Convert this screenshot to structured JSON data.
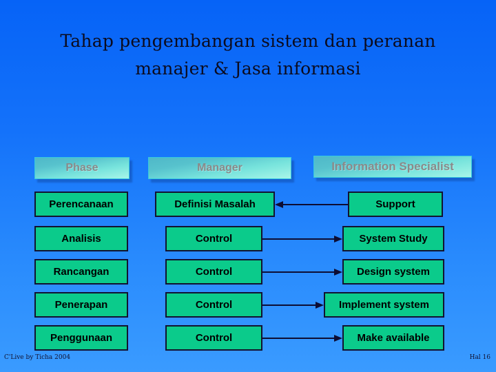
{
  "slide": {
    "title": "Tahap pengembangan sistem dan peranan\nmanajer & Jasa informasi",
    "background_top_color": "#0663F7",
    "background_bottom_color": "#3A9BFF"
  },
  "headers": [
    {
      "label": "Phase",
      "name": "header-phase"
    },
    {
      "label": "Manager",
      "name": "header-manager"
    },
    {
      "label": "Information Specialist",
      "name": "header-information-specialist"
    }
  ],
  "rows": [
    {
      "phase": "Perencanaan",
      "manager": "Definisi Masalah",
      "specialist": "Support",
      "arrow_direction": "left"
    },
    {
      "phase": "Analisis",
      "manager": "Control",
      "specialist": "System Study",
      "arrow_direction": "right"
    },
    {
      "phase": "Rancangan",
      "manager": "Control",
      "specialist": "Design system",
      "arrow_direction": "right"
    },
    {
      "phase": "Penerapan",
      "manager": "Control",
      "specialist": "Implement system",
      "arrow_direction": "right"
    },
    {
      "phase": "Penggunaan",
      "manager": "Control",
      "specialist": "Make available",
      "arrow_direction": "right"
    }
  ],
  "footer": {
    "left": "C'Live by Ticha 2004",
    "right": "Hal 16"
  },
  "colors": {
    "box_fill": "#0BCB8B",
    "box_border": "#121230",
    "header_text": "#8A8A8A",
    "arrow": "#0D0D33",
    "title_text": "#0b0b1e"
  }
}
